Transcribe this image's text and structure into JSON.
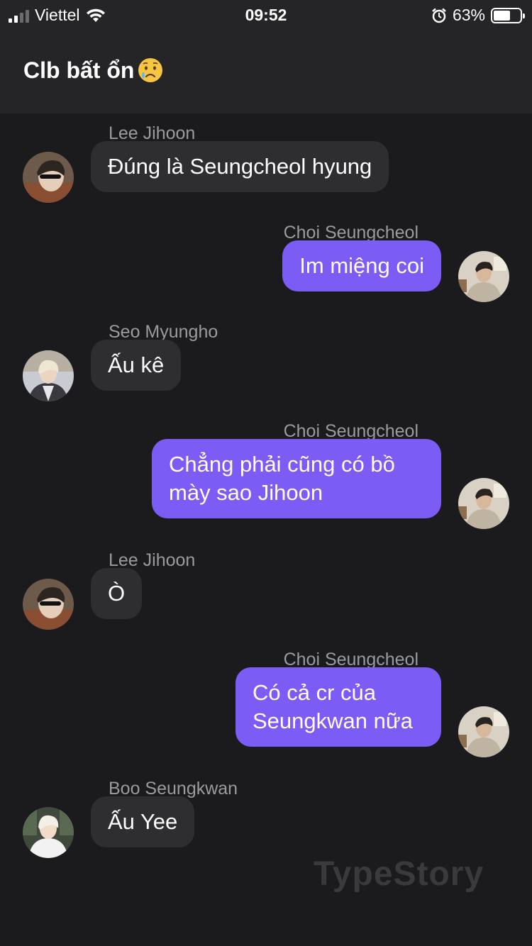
{
  "status_bar": {
    "carrier": "Viettel",
    "time": "09:52",
    "battery_percent": "63%",
    "battery_level": 0.63,
    "icons": [
      "signal-icon",
      "wifi-icon",
      "alarm-icon",
      "battery-icon"
    ]
  },
  "header": {
    "title": "Clb bất ổn",
    "title_emoji": "crying-face-emoji"
  },
  "messages": [
    {
      "sender": "Lee Jihoon",
      "text": "Đúng là Seungcheol hyung",
      "direction": "received",
      "avatar": "lee-jihoon-avatar"
    },
    {
      "sender": "Choi Seungcheol",
      "text": "Im miệng coi",
      "direction": "sent",
      "avatar": "choi-seungcheol-avatar"
    },
    {
      "sender": "Seo Myungho",
      "text": "Ấu kê",
      "direction": "received",
      "avatar": "seo-myungho-avatar"
    },
    {
      "sender": "Choi Seungcheol",
      "text": "Chẳng phải cũng có bồ mày sao Jihoon",
      "direction": "sent",
      "avatar": "choi-seungcheol-avatar"
    },
    {
      "sender": "Lee Jihoon",
      "text": "Ò",
      "direction": "received",
      "avatar": "lee-jihoon-avatar"
    },
    {
      "sender": "Choi Seungcheol",
      "text": "Có cả cr của Seungkwan nữa",
      "direction": "sent",
      "avatar": "choi-seungcheol-avatar"
    },
    {
      "sender": "Boo Seungkwan",
      "text": "Ấu Yee",
      "direction": "received",
      "avatar": "boo-seungkwan-avatar"
    }
  ],
  "watermark": "TypeStory",
  "colors": {
    "background": "#1b1b1d",
    "header": "#252527",
    "sent_bubble": "#7b5cf5",
    "received_bubble": "#2e2e31",
    "sender_name": "#9a9aa0"
  }
}
